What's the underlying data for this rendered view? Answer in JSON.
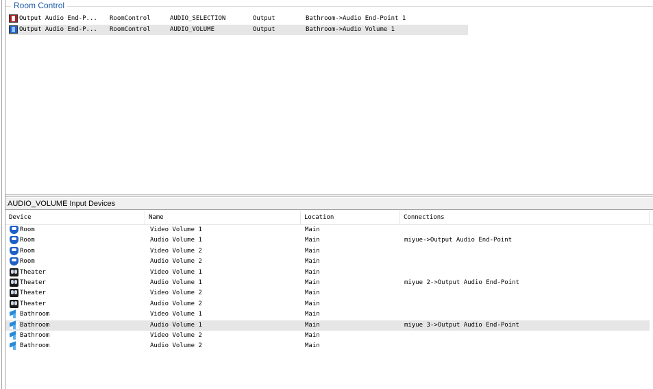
{
  "room_control": {
    "title": "Room Control",
    "rows": [
      {
        "icon": "output-red-icon",
        "device": "Output Audio End-P...",
        "type": "RoomControl",
        "control": "AUDIO_SELECTION",
        "direction": "Output",
        "connection": "Bathroom->Audio End-Point 1",
        "selected": false
      },
      {
        "icon": "output-blue-icon",
        "device": "Output Audio End-P...",
        "type": "RoomControl",
        "control": "AUDIO_VOLUME",
        "direction": "Output",
        "connection": "Bathroom->Audio Volume 1",
        "selected": true
      }
    ]
  },
  "input_devices": {
    "title": "AUDIO_VOLUME Input Devices",
    "columns": [
      "Device",
      "Name",
      "Location",
      "Connections"
    ],
    "rows": [
      {
        "icon": "room-icon",
        "device": "Room",
        "name": "Video Volume 1",
        "location": "Main",
        "connections": "",
        "selected": false
      },
      {
        "icon": "room-icon",
        "device": "Room",
        "name": "Audio Volume 1",
        "location": "Main",
        "connections": "miyue->Output Audio End-Point",
        "selected": false
      },
      {
        "icon": "room-icon",
        "device": "Room",
        "name": "Video Volume 2",
        "location": "Main",
        "connections": "",
        "selected": false
      },
      {
        "icon": "room-icon",
        "device": "Room",
        "name": "Audio Volume 2",
        "location": "Main",
        "connections": "",
        "selected": false
      },
      {
        "icon": "theater-icon",
        "device": "Theater",
        "name": "Video Volume 1",
        "location": "Main",
        "connections": "",
        "selected": false
      },
      {
        "icon": "theater-icon",
        "device": "Theater",
        "name": "Audio Volume 1",
        "location": "Main",
        "connections": "miyue 2->Output Audio End-Point",
        "selected": false
      },
      {
        "icon": "theater-icon",
        "device": "Theater",
        "name": "Video Volume 2",
        "location": "Main",
        "connections": "",
        "selected": false
      },
      {
        "icon": "theater-icon",
        "device": "Theater",
        "name": "Audio Volume 2",
        "location": "Main",
        "connections": "",
        "selected": false
      },
      {
        "icon": "bathroom-icon",
        "device": "Bathroom",
        "name": "Video Volume 1",
        "location": "Main",
        "connections": "",
        "selected": false
      },
      {
        "icon": "bathroom-icon",
        "device": "Bathroom",
        "name": "Audio Volume 1",
        "location": "Main",
        "connections": "miyue 3->Output Audio End-Point",
        "selected": true
      },
      {
        "icon": "bathroom-icon",
        "device": "Bathroom",
        "name": "Video Volume 2",
        "location": "Main",
        "connections": "",
        "selected": false
      },
      {
        "icon": "bathroom-icon",
        "device": "Bathroom",
        "name": "Audio Volume 2",
        "location": "Main",
        "connections": "",
        "selected": false
      }
    ]
  }
}
